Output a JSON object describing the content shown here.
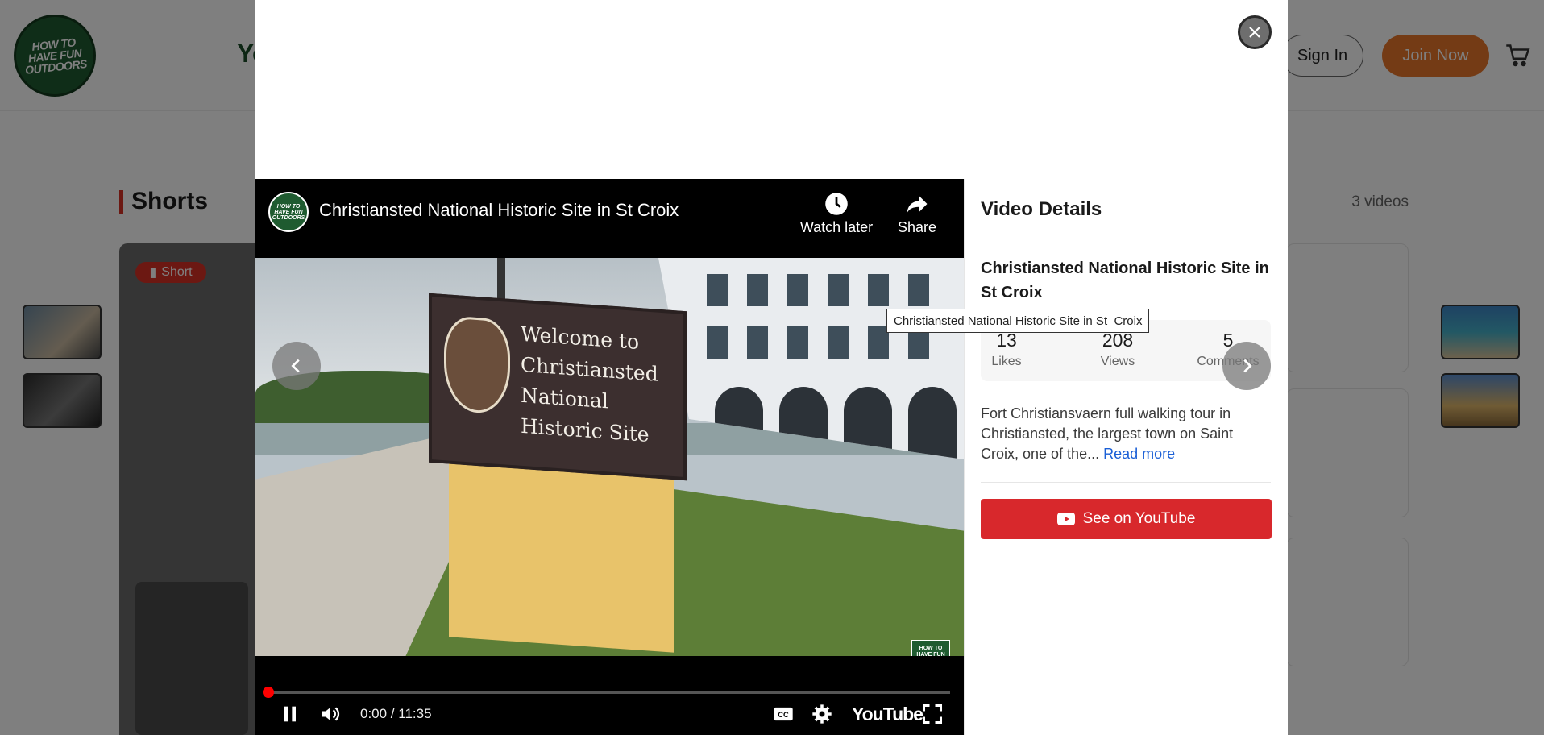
{
  "header": {
    "logo_text": "HOW TO HAVE FUN OUTDOORS",
    "nav_partial": "Yo",
    "signin_label": "Sign In",
    "join_label": "Join Now"
  },
  "section": {
    "title": "Shorts",
    "count": "3 videos",
    "badge": "Short"
  },
  "player": {
    "title": "Christiansted National Historic Site in St Croix",
    "watch_later": "Watch later",
    "share": "Share",
    "sign_lines": [
      "Welcome to",
      "Christiansted",
      "National Historic Site"
    ],
    "watermark": "HOW TO HAVE FUN OUTDOORS SUBSCRIBE",
    "time": "0:00 / 11:35",
    "progress": 0,
    "yt_logo": "YouTube"
  },
  "details": {
    "heading": "Video Details",
    "title": "Christiansted National Historic Site in St Croix",
    "likes_value": "13",
    "likes_label": "Likes",
    "views_value": "208",
    "views_label": "Views",
    "comments_value": "5",
    "comments_label": "Comments",
    "description": "Fort Christiansvaern full walking tour in Christiansted, the largest town on Saint Croix, one of the...",
    "read_more": "Read more",
    "youtube_button": "See on YouTube"
  },
  "tooltip": "Christiansted National Historic Site in St  Croix",
  "colors": {
    "brand_green": "#1f5b30",
    "join_orange": "#e8762a",
    "youtube_red": "#d8282c",
    "link_blue": "#1a5fd6"
  }
}
